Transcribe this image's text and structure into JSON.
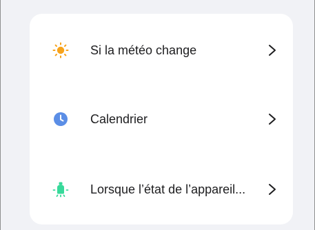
{
  "conditions": {
    "items": [
      {
        "label": "Si la météo change",
        "icon": "sun-icon",
        "icon_color": "#f7a31b"
      },
      {
        "label": "Calendrier",
        "icon": "clock-icon",
        "icon_color": "#5b8ee6"
      },
      {
        "label": "Lorsque l’état de l’appareil...",
        "icon": "device-bulb-icon",
        "icon_color": "#37d99a"
      }
    ]
  },
  "colors": {
    "background": "#f1f2f6",
    "card": "#ffffff",
    "text": "#1d1d1f",
    "chevron": "#1d1d1f"
  }
}
